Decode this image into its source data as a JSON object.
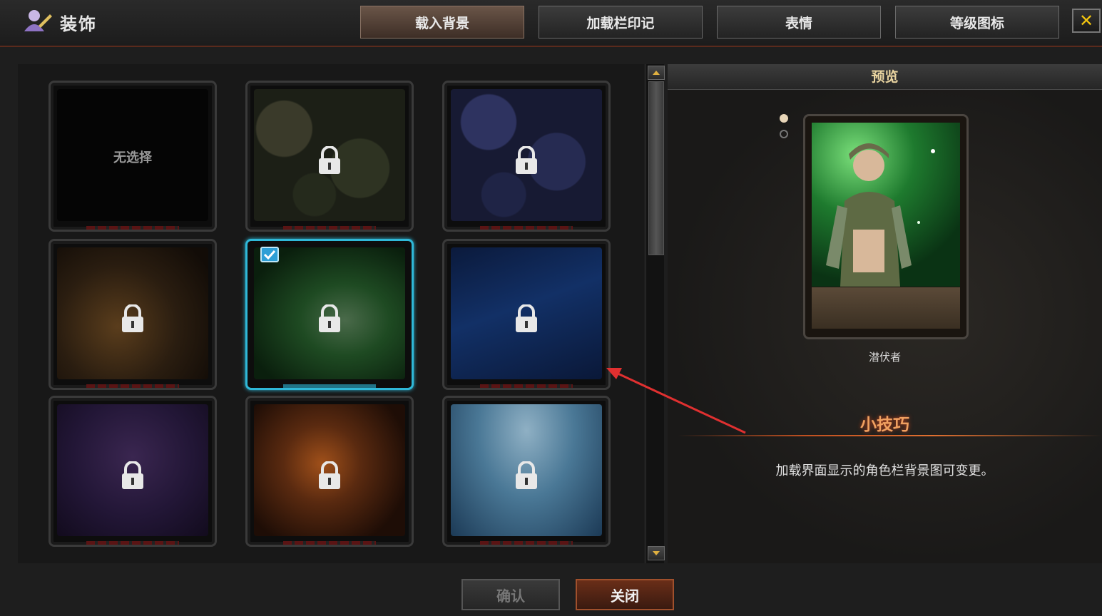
{
  "header": {
    "title": "装饰",
    "tabs": [
      {
        "label": "载入背景",
        "active": true
      },
      {
        "label": "加载栏印记",
        "active": false
      },
      {
        "label": "表情",
        "active": false
      },
      {
        "label": "等级图标",
        "active": false
      }
    ],
    "close_icon": "close-x-icon"
  },
  "grid": {
    "items": [
      {
        "label": "无选择",
        "locked": false,
        "selected": false,
        "bg": "black"
      },
      {
        "locked": true,
        "selected": false,
        "bg": "green-camo"
      },
      {
        "locked": true,
        "selected": false,
        "bg": "blue-camo"
      },
      {
        "locked": true,
        "selected": false,
        "bg": "amber-bokeh"
      },
      {
        "locked": true,
        "selected": true,
        "bg": "green-nebula"
      },
      {
        "locked": true,
        "selected": false,
        "bg": "blue-light"
      },
      {
        "locked": true,
        "selected": false,
        "bg": "purple-stars"
      },
      {
        "locked": true,
        "selected": false,
        "bg": "fire"
      },
      {
        "locked": true,
        "selected": false,
        "bg": "ice"
      }
    ]
  },
  "preview": {
    "title": "预览",
    "character_name": "潜伏者",
    "tips_title": "小技巧",
    "tips_text": "加载界面显示的角色栏背景图可变更。"
  },
  "buttons": {
    "confirm": "确认",
    "close": "关闭"
  },
  "colors": {
    "accent_selected": "#2fb8d8",
    "tips_title": "#f0a060",
    "close_x": "#f1c40f"
  }
}
